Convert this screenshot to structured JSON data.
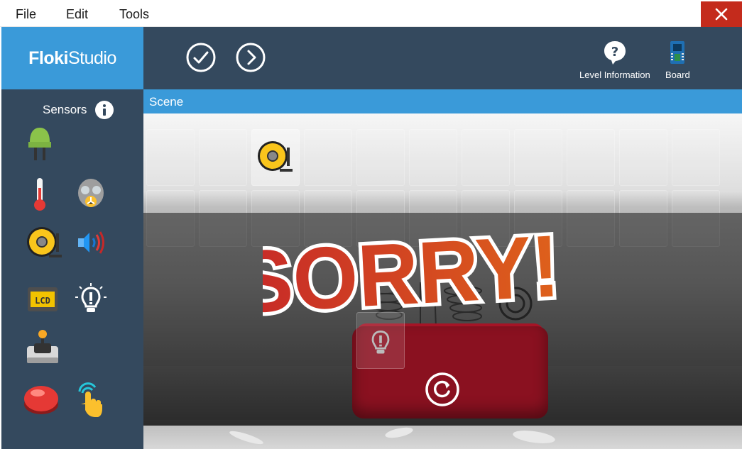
{
  "menu": {
    "file": "File",
    "edit": "Edit",
    "tools": "Tools"
  },
  "logo": {
    "bold": "Floki",
    "light": "Studio"
  },
  "toolbar": {
    "level_information": "Level Information",
    "board": "Board"
  },
  "sidebar": {
    "title": "Sensors",
    "items": [
      "led",
      "thermometer",
      "gas-sensor",
      "alarm-bell",
      "speaker",
      "lcd",
      "light-bulb",
      "joystick",
      "red-button",
      "touch-sensor"
    ]
  },
  "scene": {
    "header": "Scene",
    "overlay_text": "SORRY!!"
  },
  "colors": {
    "accent": "#3a9ad9",
    "panel": "#34495e",
    "close": "#c42b1c"
  }
}
